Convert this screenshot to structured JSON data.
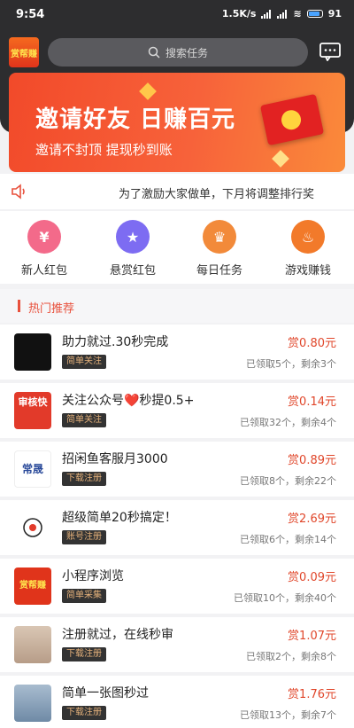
{
  "status": {
    "time": "9:54",
    "speed": "1.5K/s",
    "battery": "91"
  },
  "header": {
    "logo_text": "赏帮赚",
    "search_placeholder": "搜索任务"
  },
  "banner": {
    "title": "邀请好友 日赚百元",
    "subtitle": "邀请不封顶 提现秒到账"
  },
  "notice": {
    "text": "为了激励大家做单，下月将调整排行奖"
  },
  "categories": [
    {
      "label": "新人红包",
      "icon": "money-bag-icon",
      "color": "#f36a8a"
    },
    {
      "label": "悬赏红包",
      "icon": "star-icon",
      "color": "#7d6cf2"
    },
    {
      "label": "每日任务",
      "icon": "crown-icon",
      "color": "#f28a3a"
    },
    {
      "label": "游戏赚钱",
      "icon": "flame-icon",
      "color": "#f27a2a"
    }
  ],
  "section": {
    "title": "热门推荐"
  },
  "tasks": [
    {
      "title": "助力就过.30秒完成",
      "tag": "简单关注",
      "price": "赏0.80元",
      "stat": "已领取5个，剩余3个",
      "thumb_color": "#111111"
    },
    {
      "title": "关注公众号❤️秒提0.5+",
      "tag": "简单关注",
      "price": "赏0.14元",
      "stat": "已领取32个，剩余4个",
      "thumb_text": "审核快",
      "thumb_color": "#e23a2a"
    },
    {
      "title": "招闲鱼客服月3000",
      "tag": "下载注册",
      "price": "赏0.89元",
      "stat": "已领取8个，剩余22个",
      "thumb_text": "常晟",
      "thumb_color": "#ffffff"
    },
    {
      "title": "超级简单20秒搞定！",
      "tag": "账号注册",
      "price": "赏2.69元",
      "stat": "已领取6个，剩余14个",
      "thumb_color": "#ffffff"
    },
    {
      "title": "小程序浏览",
      "tag": "简单采集",
      "price": "赏0.09元",
      "stat": "已领取10个，剩余40个",
      "thumb_text": "赏帮赚",
      "thumb_color": "#e0341b"
    },
    {
      "title": "注册就过，在线秒审",
      "tag": "下载注册",
      "price": "赏1.07元",
      "stat": "已领取2个，剩余8个",
      "thumb_color": "#c9b8a8"
    },
    {
      "title": "简单一张图秒过",
      "tag": "下载注册",
      "price": "赏1.76元",
      "stat": "已领取13个，剩余7个",
      "thumb_color": "#8aa0b8"
    }
  ]
}
